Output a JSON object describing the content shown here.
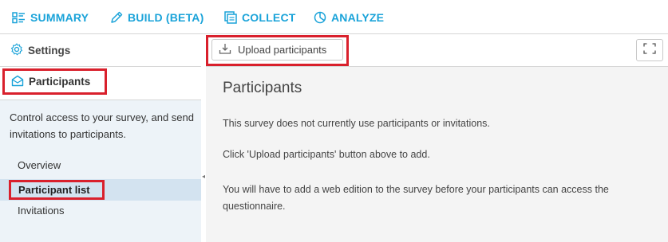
{
  "nav": {
    "summary": "SUMMARY",
    "build": "BUILD (BETA)",
    "collect": "COLLECT",
    "analyze": "ANALYZE"
  },
  "sidebar": {
    "settings": "Settings",
    "participants": "Participants",
    "description": "Control access to your survey, and send invitations to participants.",
    "links": {
      "overview": "Overview",
      "participant_list": "Participant list",
      "invitations": "Invitations"
    }
  },
  "toolbar": {
    "upload_label": "Upload participants"
  },
  "main": {
    "title": "Participants",
    "para1": "This survey does not currently use participants or invitations.",
    "para2": "Click 'Upload participants' button above to add.",
    "para3": "You will have to add a web edition to the survey before your participants can access the questionnaire."
  },
  "colors": {
    "accent": "#1aa3d9",
    "highlight": "#d9202c",
    "sidebar_bg": "#edf3f8",
    "active_row": "#d3e3f0"
  },
  "icons": [
    "summary-icon",
    "pencil-icon",
    "collect-icon",
    "analyze-icon",
    "gear-icon",
    "envelope-icon",
    "upload-icon",
    "fullscreen-icon"
  ]
}
